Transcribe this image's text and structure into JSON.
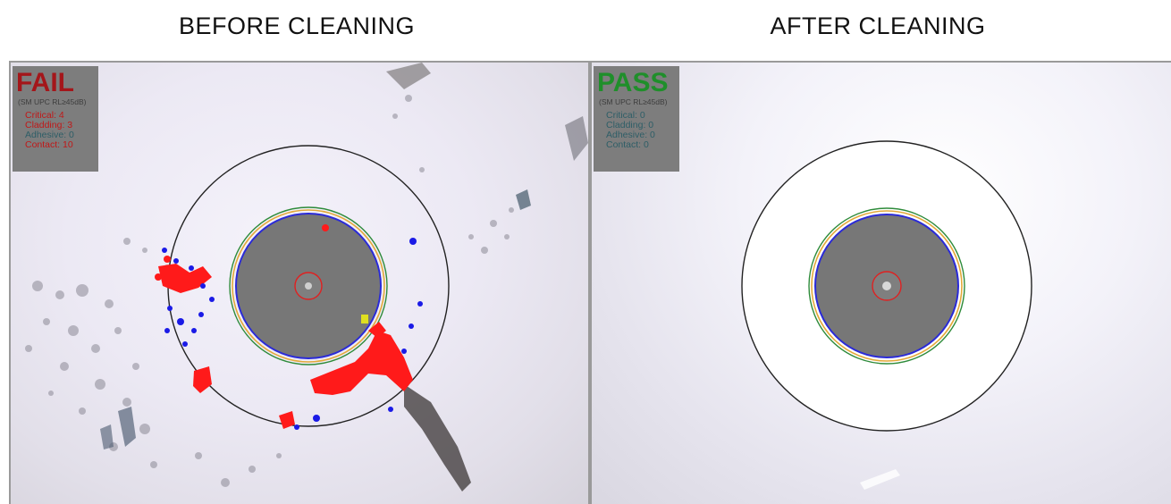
{
  "headings": {
    "before": "BEFORE CLEANING",
    "after": "AFTER CLEANING"
  },
  "before": {
    "result": "FAIL",
    "spec": "(SM UPC RL≥45dB)",
    "counts": [
      {
        "label": "Critical: 4"
      },
      {
        "label": "Cladding: 3"
      },
      {
        "label": "Adhesive: 0"
      },
      {
        "label": "Contact: 10"
      }
    ]
  },
  "after": {
    "result": "PASS",
    "spec": "(SM UPC RL≥45dB)",
    "counts": [
      {
        "label": "Critical: 0"
      },
      {
        "label": "Cladding: 0"
      },
      {
        "label": "Adhesive: 0"
      },
      {
        "label": "Contact: 0"
      }
    ]
  },
  "colors": {
    "fail": "#a4161a",
    "pass": "#1f8f2a",
    "defect_red": "#ff1a1a",
    "defect_blue": "#1a1ae6",
    "zone_outer": "#222222",
    "zone_cladding": "#2e8b3a",
    "zone_core": "#e02020"
  }
}
